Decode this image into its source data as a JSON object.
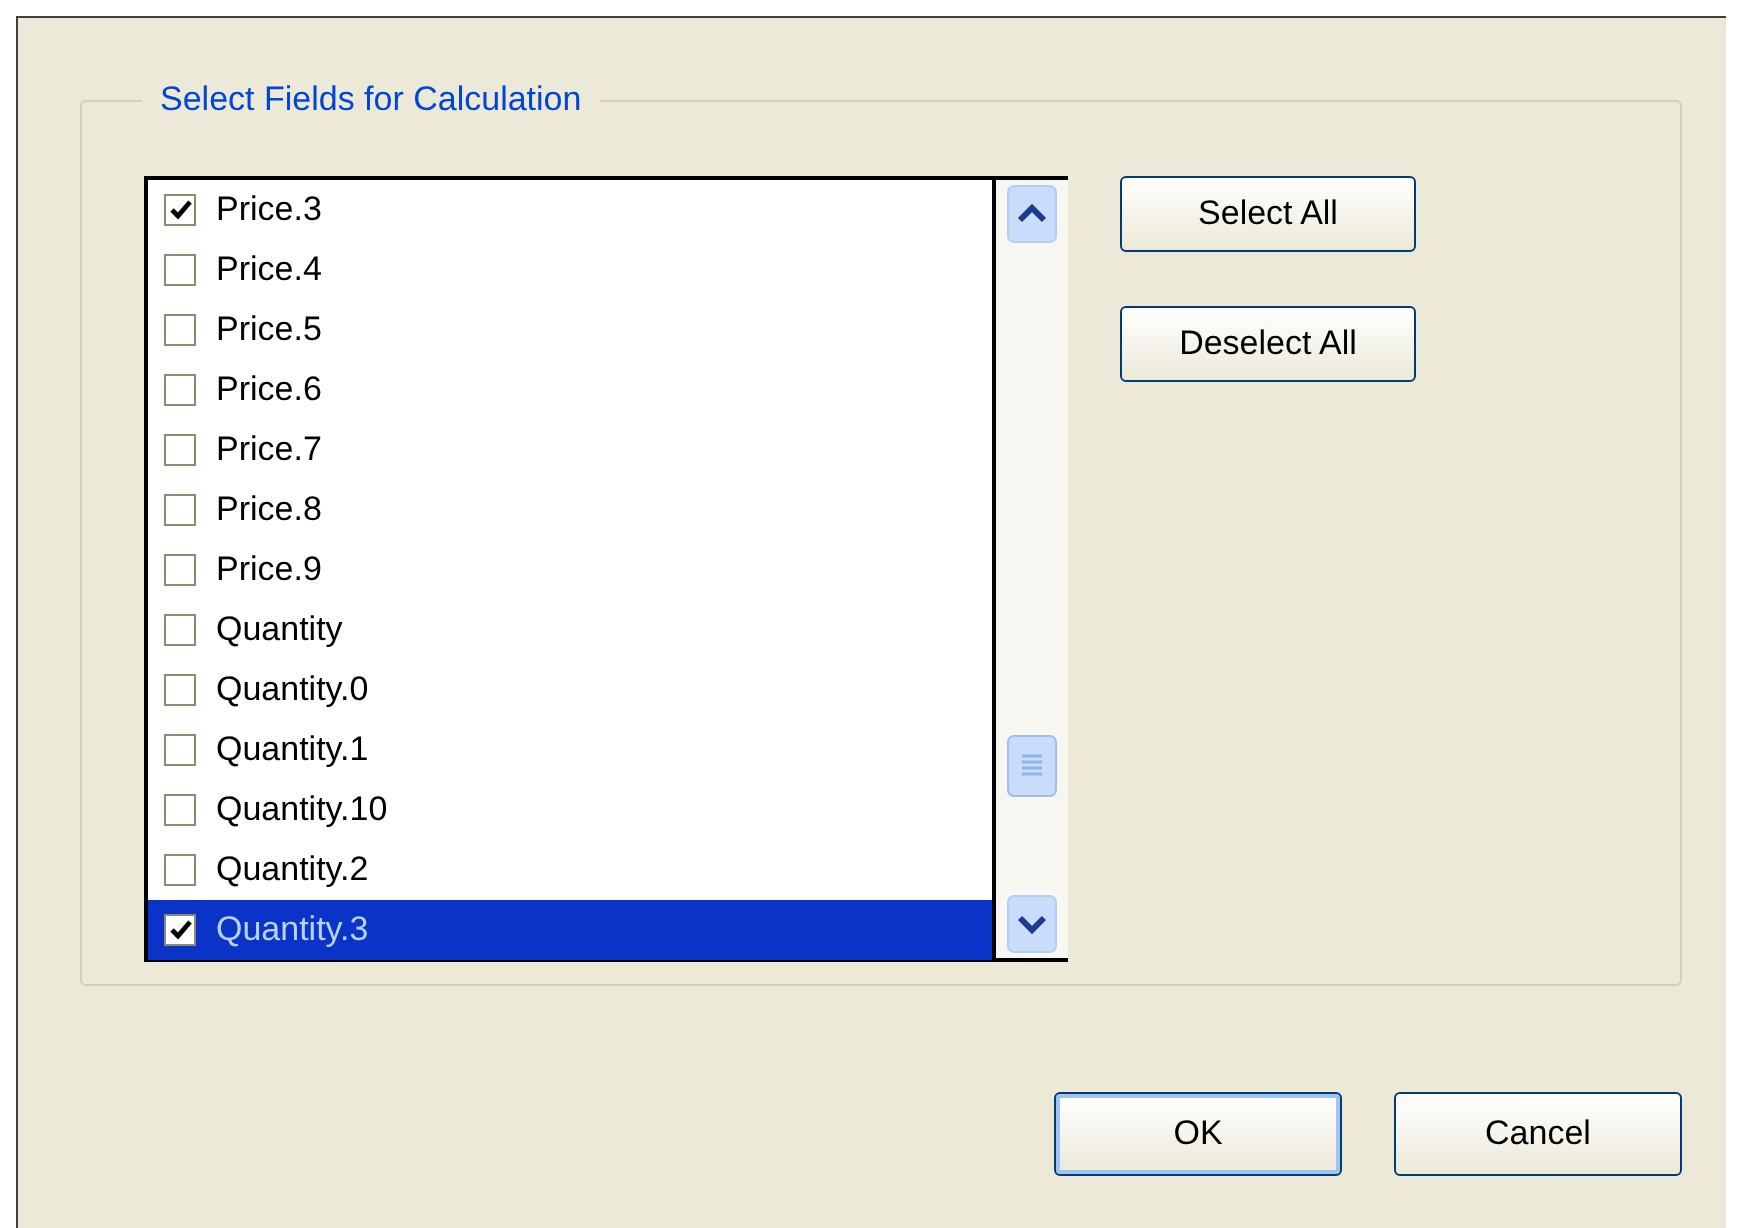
{
  "group": {
    "title": "Select Fields for Calculation"
  },
  "fields": [
    {
      "label": "Price.3",
      "checked": true,
      "selected": false
    },
    {
      "label": "Price.4",
      "checked": false,
      "selected": false
    },
    {
      "label": "Price.5",
      "checked": false,
      "selected": false
    },
    {
      "label": "Price.6",
      "checked": false,
      "selected": false
    },
    {
      "label": "Price.7",
      "checked": false,
      "selected": false
    },
    {
      "label": "Price.8",
      "checked": false,
      "selected": false
    },
    {
      "label": "Price.9",
      "checked": false,
      "selected": false
    },
    {
      "label": "Quantity",
      "checked": false,
      "selected": false
    },
    {
      "label": "Quantity.0",
      "checked": false,
      "selected": false
    },
    {
      "label": "Quantity.1",
      "checked": false,
      "selected": false
    },
    {
      "label": "Quantity.10",
      "checked": false,
      "selected": false
    },
    {
      "label": "Quantity.2",
      "checked": false,
      "selected": false
    },
    {
      "label": "Quantity.3",
      "checked": true,
      "selected": true
    }
  ],
  "side_buttons": [
    "Select All",
    "Deselect All"
  ],
  "buttons": [
    {
      "label": "OK",
      "default": true
    },
    {
      "label": "Cancel",
      "default": false
    }
  ]
}
